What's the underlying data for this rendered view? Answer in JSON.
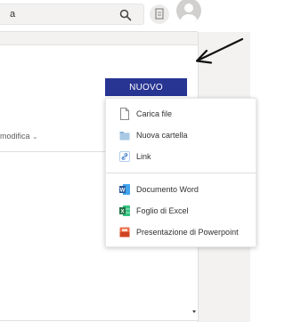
{
  "search": {
    "text": "a"
  },
  "header": {
    "buttons": {
      "new_label": "NUOVO"
    }
  },
  "columns": {
    "modified_label": "modifica",
    "modified_chevron": "⌄"
  },
  "menu": {
    "items": [
      {
        "label": "Carica file",
        "icon": "file-icon"
      },
      {
        "label": "Nuova cartella",
        "icon": "folder-icon"
      },
      {
        "label": "Link",
        "icon": "link-icon"
      },
      {
        "label": "Documento Word",
        "icon": "word-icon"
      },
      {
        "label": "Foglio di Excel",
        "icon": "excel-icon"
      },
      {
        "label": "Presentazione di Powerpoint",
        "icon": "powerpoint-icon"
      }
    ]
  },
  "colors": {
    "primary_button": "#283593",
    "word": "#2b579a",
    "excel": "#217346",
    "powerpoint": "#d04423",
    "folder": "#8cb6d8",
    "link": "#5b8fd1"
  }
}
